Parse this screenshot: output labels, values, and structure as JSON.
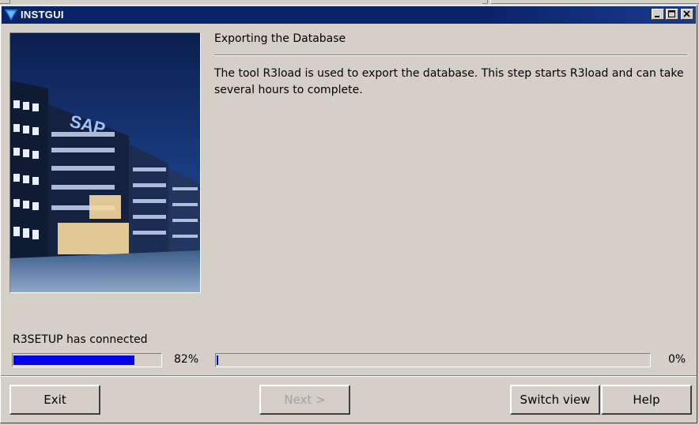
{
  "window": {
    "title": "INSTGUI"
  },
  "content": {
    "heading": "Exporting the Database",
    "description": "The tool R3load is used to export the database. This step starts R3load and can take several hours to complete."
  },
  "photo": {
    "sign_text": "SAP"
  },
  "status": {
    "text": "R3SETUP has connected",
    "overall_progress_label": "82%",
    "overall_progress": 0.82,
    "step_progress_label": "0%",
    "step_progress": 0.0
  },
  "buttons": {
    "exit": "Exit",
    "next": "Next >",
    "switch_view": "Switch view",
    "help": "Help"
  },
  "colors": {
    "titlebar": "#0a246a",
    "progress_fill": "#0000ee",
    "window_bg": "#d4d0c8"
  }
}
